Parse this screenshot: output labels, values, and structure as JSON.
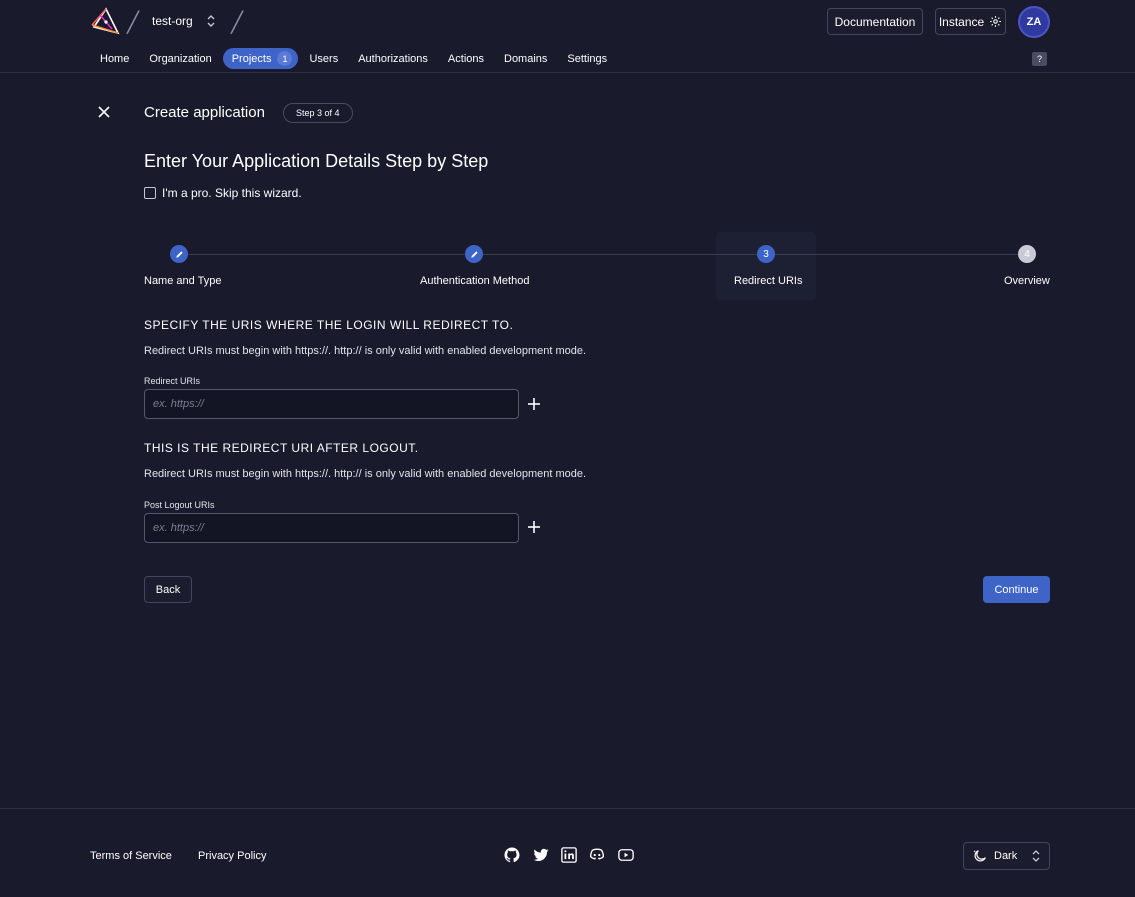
{
  "header": {
    "org_name": "test-org",
    "documentation_label": "Documentation",
    "instance_label": "Instance",
    "avatar_initials": "ZA",
    "help_label": "?"
  },
  "nav": {
    "items": [
      {
        "label": "Home"
      },
      {
        "label": "Organization"
      },
      {
        "label": "Projects",
        "badge": "1",
        "active": true
      },
      {
        "label": "Users"
      },
      {
        "label": "Authorizations"
      },
      {
        "label": "Actions"
      },
      {
        "label": "Domains"
      },
      {
        "label": "Settings"
      }
    ]
  },
  "main": {
    "title": "Create application",
    "step_chip": "Step 3 of 4",
    "wizard_title": "Enter Your Application Details Step by Step",
    "pro_skip_label": "I'm a pro. Skip this wizard.",
    "steps": [
      {
        "label": "Name and Type",
        "state": "done"
      },
      {
        "label": "Authentication Method",
        "state": "done"
      },
      {
        "label": "Redirect URIs",
        "state": "current",
        "number": "3"
      },
      {
        "label": "Overview",
        "state": "future",
        "number": "4"
      }
    ],
    "redirect_section": {
      "title": "SPECIFY THE URIS WHERE THE LOGIN WILL REDIRECT TO.",
      "description": "Redirect URIs must begin with https://. http:// is only valid with enabled development mode.",
      "field_label": "Redirect URIs",
      "placeholder": "ex. https://",
      "value": ""
    },
    "logout_section": {
      "title": "THIS IS THE REDIRECT URI AFTER LOGOUT.",
      "description": "Redirect URIs must begin with https://. http:// is only valid with enabled development mode.",
      "field_label": "Post Logout URIs",
      "placeholder": "ex. https://",
      "value": ""
    },
    "back_label": "Back",
    "continue_label": "Continue"
  },
  "footer": {
    "terms_label": "Terms of Service",
    "privacy_label": "Privacy Policy",
    "social_icons": [
      "github-icon",
      "twitter-icon",
      "linkedin-icon",
      "discord-icon",
      "youtube-icon"
    ],
    "theme_label": "Dark"
  },
  "colors": {
    "background": "#191a2c",
    "accent": "#3e64c7",
    "border": "#44465e"
  }
}
